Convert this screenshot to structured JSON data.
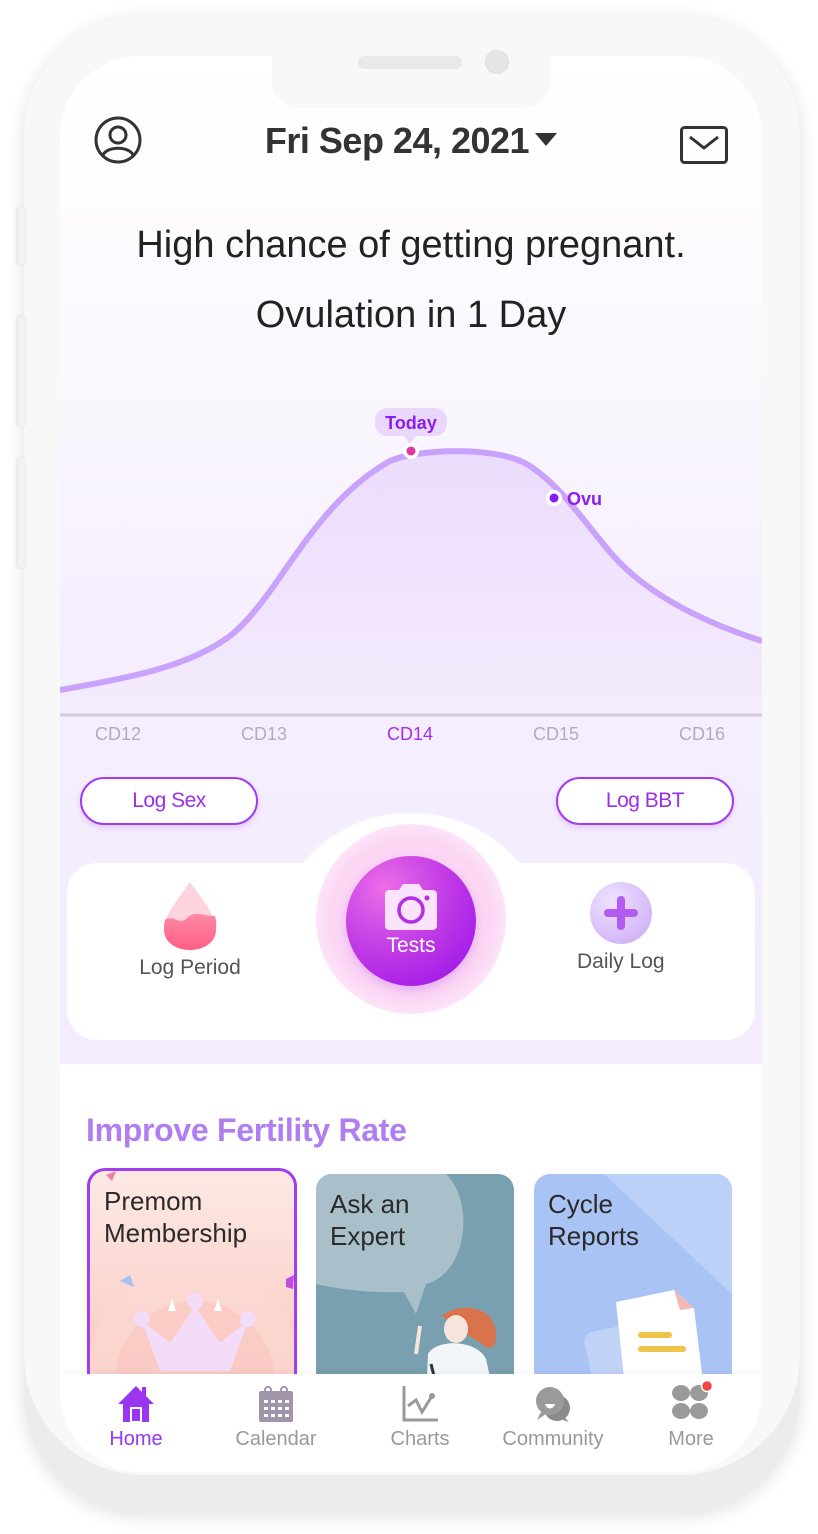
{
  "header": {
    "date": "Fri Sep 24, 2021",
    "profile_icon": "user-circle-icon",
    "mail_icon": "envelope-icon"
  },
  "status": {
    "headline": "High chance of getting pregnant.",
    "subheadline": "Ovulation in 1 Day"
  },
  "fertility_chart": {
    "today_label": "Today",
    "ovulation_label": "Ovu",
    "days": [
      "CD12",
      "CD13",
      "CD14",
      "CD15",
      "CD16"
    ],
    "active_day": "CD14",
    "colors": {
      "line": "#c8a2fb",
      "today_dot": "#e0379b",
      "ovu_dot": "#8a1ef0",
      "fill": "#efe2fd"
    }
  },
  "quick_log": {
    "log_sex": "Log Sex",
    "log_bbt": "Log BBT",
    "log_period": "Log Period",
    "tests": "Tests",
    "daily_log": "Daily Log"
  },
  "fertility_section": {
    "title": "Improve Fertility Rate",
    "cards": [
      {
        "title_line1": "Premom",
        "title_line2": "Membership"
      },
      {
        "title_line1": "Ask an",
        "title_line2": "Expert"
      },
      {
        "title_line1": "Cycle",
        "title_line2": "Reports"
      }
    ]
  },
  "bottom_nav": {
    "items": [
      {
        "label": "Home",
        "icon": "home-icon",
        "active": true
      },
      {
        "label": "Calendar",
        "icon": "calendar-icon"
      },
      {
        "label": "Charts",
        "icon": "chart-line-icon"
      },
      {
        "label": "Community",
        "icon": "chat-bubbles-icon"
      },
      {
        "label": "More",
        "icon": "grid-petals-icon",
        "badge": true
      }
    ],
    "colors": {
      "active": "#9a36f0",
      "inactive": "#999999",
      "badge": "#f24444"
    }
  }
}
